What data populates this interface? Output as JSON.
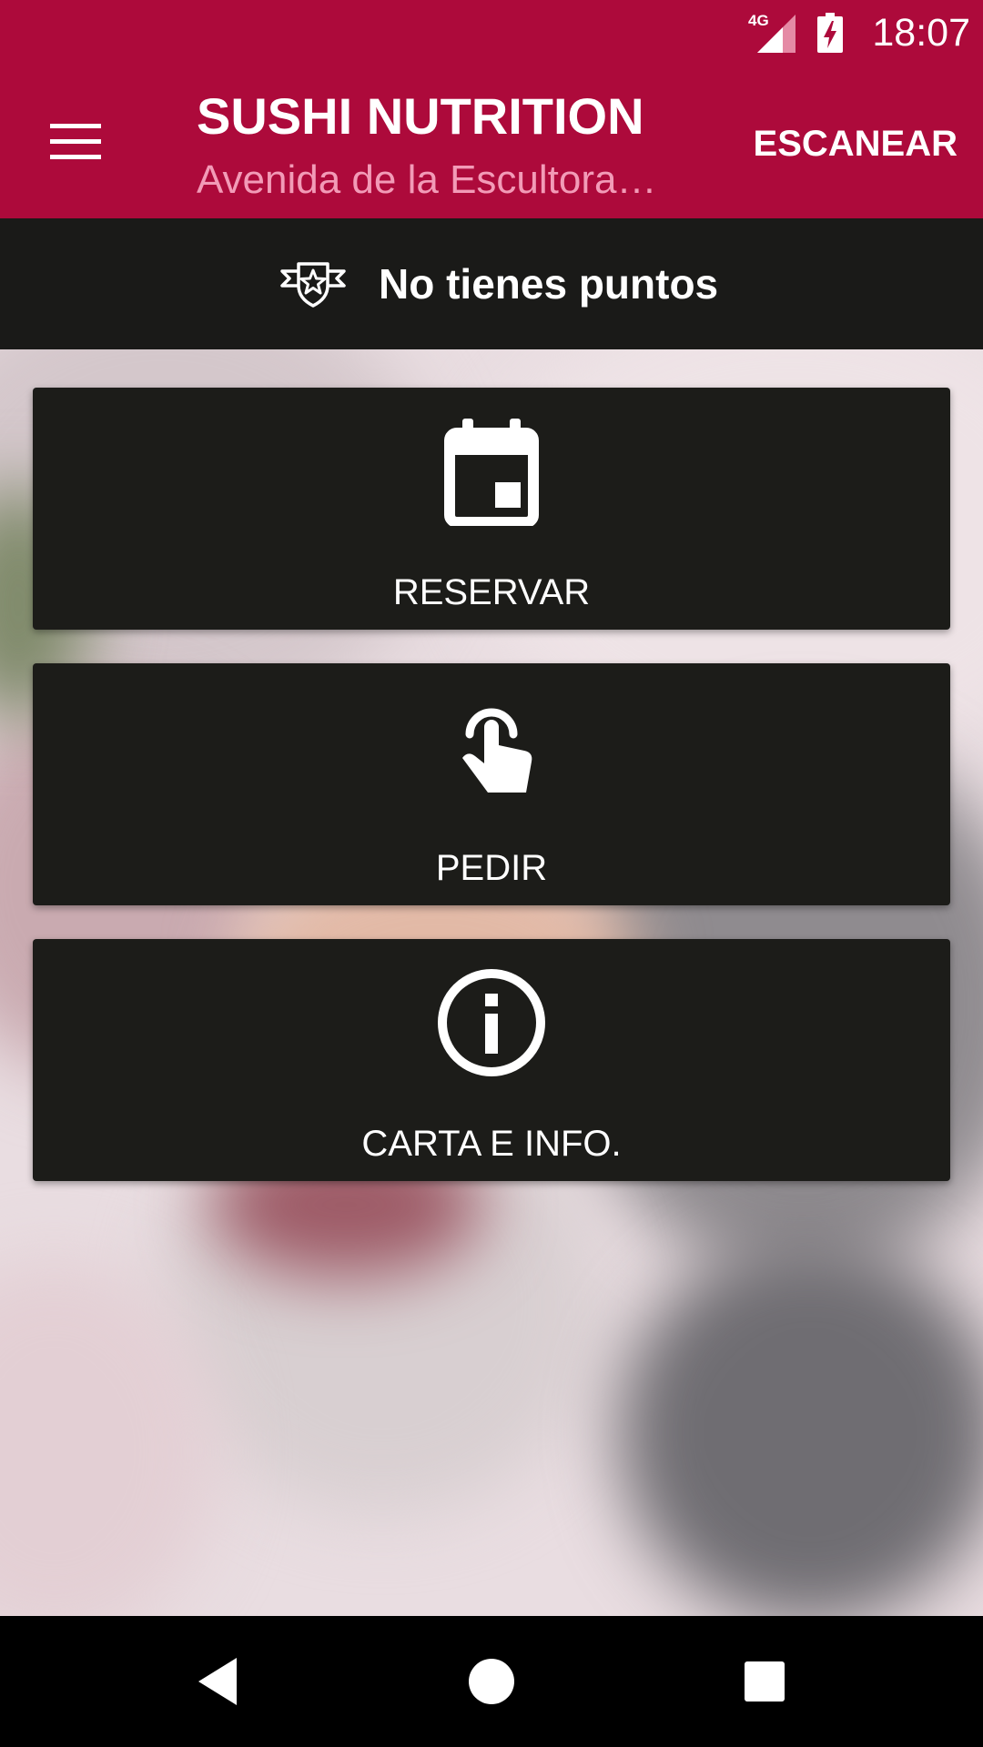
{
  "status_bar": {
    "network": "4G",
    "time": "18:07",
    "icons": [
      "signal-icon",
      "battery-charging-icon"
    ]
  },
  "app_bar": {
    "menu_icon": "hamburger-menu-icon",
    "title": "SUSHI NUTRITION",
    "subtitle": "Avenida de la Escultora…",
    "scan_label": "ESCANEAR"
  },
  "points": {
    "icon": "star-badge-icon",
    "text": "No tienes puntos"
  },
  "actions": [
    {
      "icon": "calendar-icon",
      "label": "RESERVAR"
    },
    {
      "icon": "tap-finger-icon",
      "label": "PEDIR"
    },
    {
      "icon": "info-icon",
      "label": "CARTA E INFO."
    }
  ],
  "nav_bar": {
    "icons": [
      "back-icon",
      "home-icon",
      "recents-icon"
    ]
  },
  "colors": {
    "brand": "#ad0a3b",
    "subtitle": "#f29bb7",
    "card": "#1c1c19",
    "banner": "#1a1a18"
  }
}
